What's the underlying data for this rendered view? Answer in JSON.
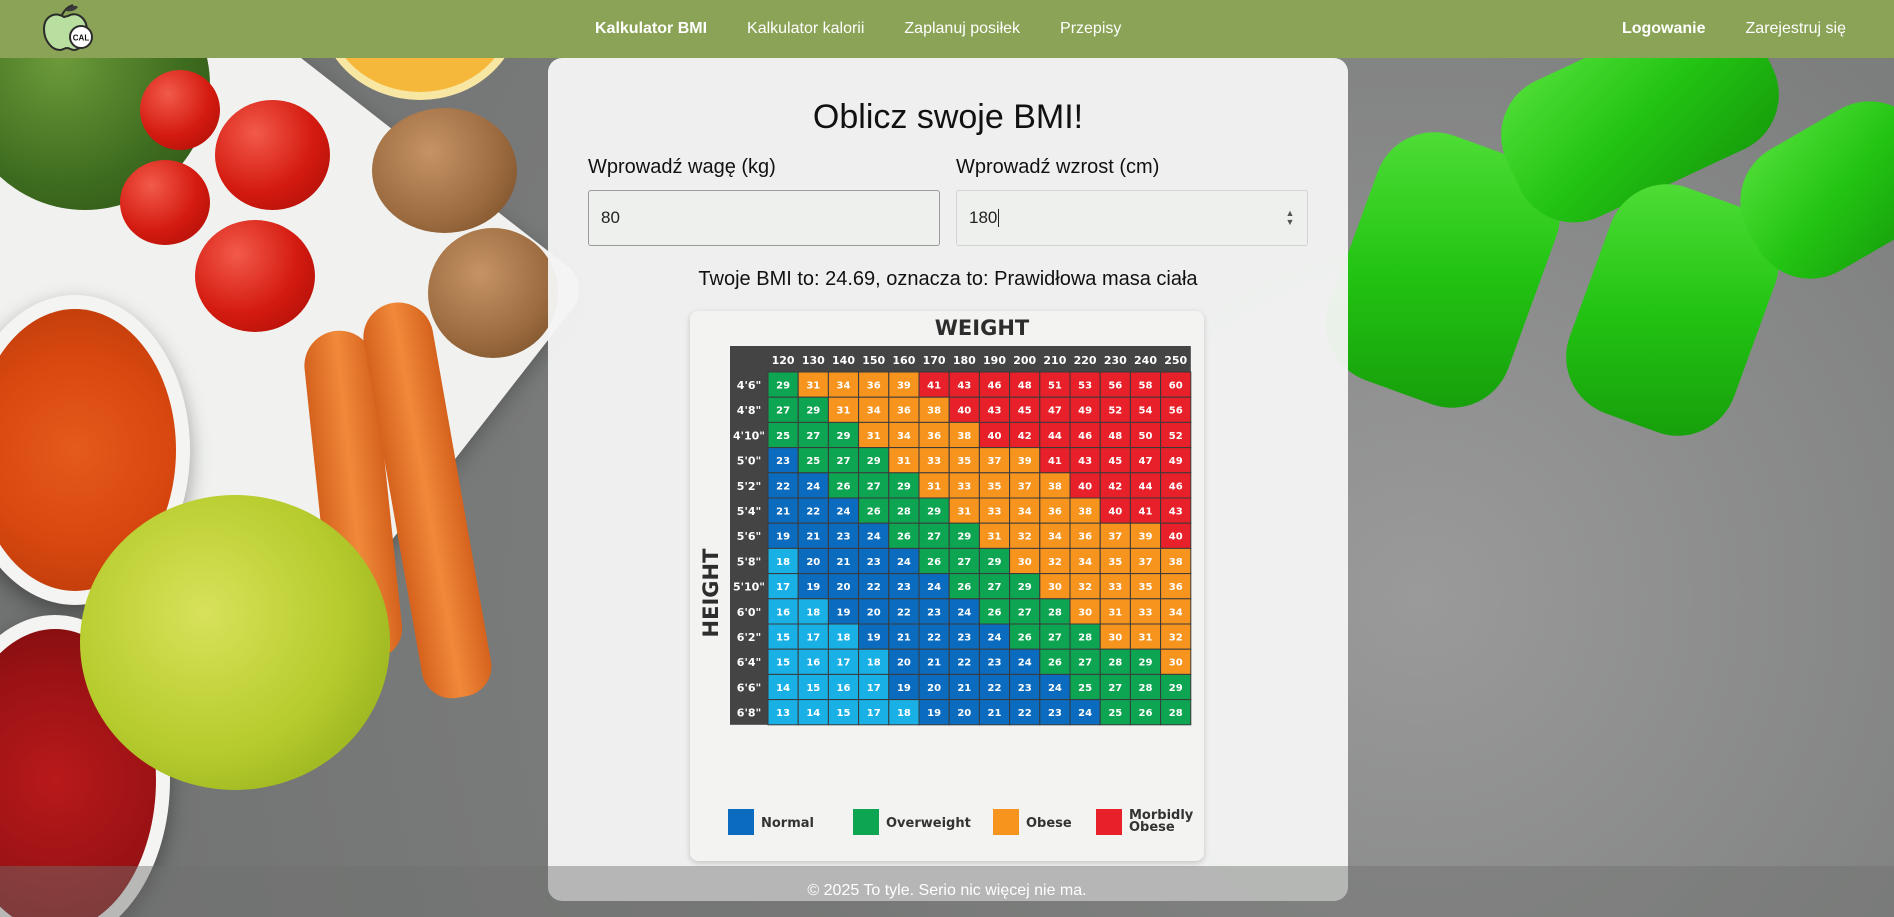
{
  "nav": {
    "logo_text": "CAL",
    "items": [
      {
        "label": "Kalkulator BMI",
        "active": true
      },
      {
        "label": "Kalkulator kalorii",
        "active": false
      },
      {
        "label": "Zaplanuj posiłek",
        "active": false
      },
      {
        "label": "Przepisy",
        "active": false
      }
    ],
    "login": "Logowanie",
    "register": "Zarejestruj się"
  },
  "form": {
    "title": "Oblicz swoje BMI!",
    "weight_label": "Wprowadź wagę (kg)",
    "weight_value": "80",
    "height_label": "Wprowadź wzrost (cm)",
    "height_value": "180"
  },
  "result_text": "Twoje BMI to: 24.69, oznacza to: Prawidłowa masa ciała",
  "bmi_table": {
    "title": "WEIGHT",
    "side_label": "HEIGHT",
    "weights": [
      "120",
      "130",
      "140",
      "150",
      "160",
      "170",
      "180",
      "190",
      "200",
      "210",
      "220",
      "230",
      "240",
      "250"
    ],
    "heights": [
      "4'6\"",
      "4'8\"",
      "4'10\"",
      "5'0\"",
      "5'2\"",
      "5'4\"",
      "5'6\"",
      "5'8\"",
      "5'10\"",
      "6'0\"",
      "6'2\"",
      "6'4\"",
      "6'6\"",
      "6'8\""
    ],
    "values": [
      [
        29,
        31,
        34,
        36,
        39,
        41,
        43,
        46,
        48,
        51,
        53,
        56,
        58,
        60
      ],
      [
        27,
        29,
        31,
        34,
        36,
        38,
        40,
        43,
        45,
        47,
        49,
        52,
        54,
        56
      ],
      [
        25,
        27,
        29,
        31,
        34,
        36,
        38,
        40,
        42,
        44,
        46,
        48,
        50,
        52
      ],
      [
        23,
        25,
        27,
        29,
        31,
        33,
        35,
        37,
        39,
        41,
        43,
        45,
        47,
        49
      ],
      [
        22,
        24,
        26,
        27,
        29,
        31,
        33,
        35,
        37,
        38,
        40,
        42,
        44,
        46
      ],
      [
        21,
        22,
        24,
        26,
        28,
        29,
        31,
        33,
        34,
        36,
        38,
        40,
        41,
        43
      ],
      [
        19,
        21,
        23,
        24,
        26,
        27,
        29,
        31,
        32,
        34,
        36,
        37,
        39,
        40
      ],
      [
        18,
        20,
        21,
        23,
        24,
        26,
        27,
        29,
        30,
        32,
        34,
        35,
        37,
        38
      ],
      [
        17,
        19,
        20,
        22,
        23,
        24,
        26,
        27,
        29,
        30,
        32,
        33,
        35,
        36
      ],
      [
        16,
        18,
        19,
        20,
        22,
        23,
        24,
        26,
        27,
        28,
        30,
        31,
        33,
        34
      ],
      [
        15,
        17,
        18,
        19,
        21,
        22,
        23,
        24,
        26,
        27,
        28,
        30,
        31,
        32
      ],
      [
        15,
        16,
        17,
        18,
        20,
        21,
        22,
        23,
        24,
        26,
        27,
        28,
        29,
        30
      ],
      [
        14,
        15,
        16,
        17,
        19,
        20,
        21,
        22,
        23,
        24,
        25,
        27,
        28,
        29
      ],
      [
        13,
        14,
        15,
        17,
        18,
        19,
        20,
        21,
        22,
        23,
        24,
        25,
        26,
        28
      ]
    ],
    "legend": [
      {
        "label": "Normal",
        "color": "#0b6cbf"
      },
      {
        "label": "Overweight",
        "color": "#0ea552"
      },
      {
        "label": "Obese",
        "color": "#f7941d"
      },
      {
        "label": "Morbidly Obese",
        "color": "#e8202a"
      }
    ],
    "underweight_color": "#19b0e6",
    "header_color": "#444444"
  },
  "footer": "© 2025 To tyle. Serio nic więcej nie ma."
}
